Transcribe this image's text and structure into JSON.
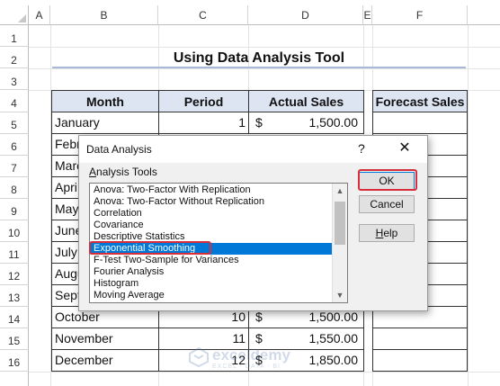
{
  "columns": [
    "A",
    "B",
    "C",
    "D",
    "E",
    "F"
  ],
  "rows": [
    "1",
    "2",
    "3",
    "4",
    "5",
    "6",
    "7",
    "8",
    "9",
    "10",
    "11",
    "12",
    "13",
    "14",
    "15",
    "16"
  ],
  "title": "Using Data Analysis Tool",
  "table": {
    "headers": [
      "Month",
      "Period",
      "Actual Sales"
    ],
    "forecast_header": "Forecast Sales",
    "rows": [
      {
        "month": "January",
        "period": "1",
        "currency": "$",
        "sales": "1,500.00"
      },
      {
        "month": "Febr",
        "period": "",
        "currency": "",
        "sales": ""
      },
      {
        "month": "Marc",
        "period": "",
        "currency": "",
        "sales": ""
      },
      {
        "month": "Apri",
        "period": "",
        "currency": "",
        "sales": ""
      },
      {
        "month": "May",
        "period": "",
        "currency": "",
        "sales": ""
      },
      {
        "month": "June",
        "period": "",
        "currency": "",
        "sales": ""
      },
      {
        "month": "July",
        "period": "",
        "currency": "",
        "sales": ""
      },
      {
        "month": "Augu",
        "period": "",
        "currency": "",
        "sales": ""
      },
      {
        "month": "Sept",
        "period": "",
        "currency": "",
        "sales": ""
      },
      {
        "month": "October",
        "period": "10",
        "currency": "$",
        "sales": "1,500.00"
      },
      {
        "month": "November",
        "period": "11",
        "currency": "$",
        "sales": "1,550.00"
      },
      {
        "month": "December",
        "period": "12",
        "currency": "$",
        "sales": "1,850.00"
      }
    ]
  },
  "dialog": {
    "title": "Data Analysis",
    "help": "?",
    "close": "✕",
    "label": "Analysis Tools",
    "tools": [
      "Anova: Two-Factor With Replication",
      "Anova: Two-Factor Without Replication",
      "Correlation",
      "Covariance",
      "Descriptive Statistics",
      "Exponential Smoothing",
      "F-Test Two-Sample for Variances",
      "Fourier Analysis",
      "Histogram",
      "Moving Average"
    ],
    "selected_tool": "Exponential Smoothing",
    "buttons": {
      "ok": "OK",
      "cancel": "Cancel",
      "help": "Help"
    }
  },
  "watermark": {
    "name": "exceldemy",
    "tagline": "EXCEL · DATA · BI"
  },
  "colors": {
    "header_fill": "#dde4f2",
    "selection": "#0078d7",
    "highlight": "#d62e3b"
  }
}
